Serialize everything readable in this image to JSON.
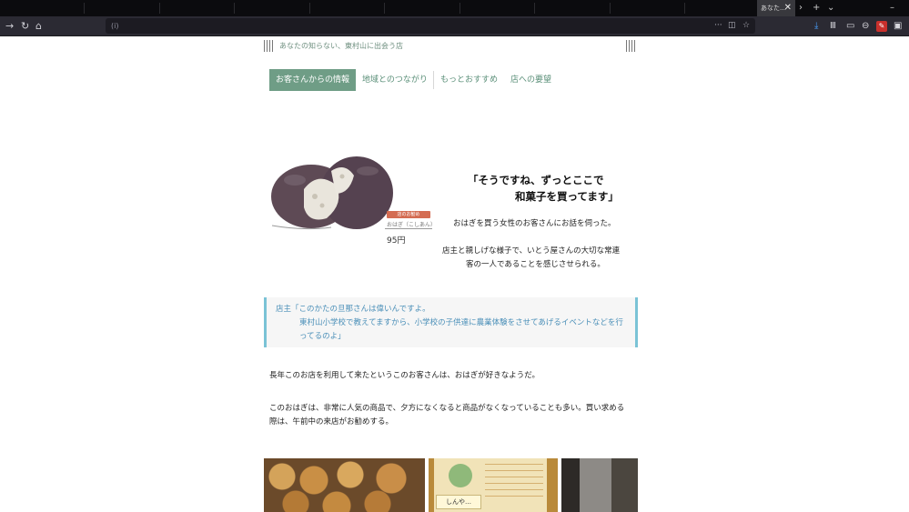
{
  "browser": {
    "tab_title": "あなた…",
    "url": "(i)"
  },
  "site": {
    "tagline": "あなたの知らない、東村山に出会う店"
  },
  "tabs": [
    {
      "label": "お客さんからの情報"
    },
    {
      "label": "地域とのつながり"
    },
    {
      "label": "もっとおすすめ"
    },
    {
      "label": "店への要望"
    }
  ],
  "product": {
    "tag": "店のお勧め",
    "name": "おはぎ（こしあん）",
    "price": "95円"
  },
  "quote": {
    "line1": "「そうですね、ずっとここで",
    "line2": "和菓子を買ってます」"
  },
  "article": {
    "lead": "おはぎを買う女性のお客さんにお話を伺った。",
    "desc_line1": "店主と親しげな様子で、いとう屋さんの大切な常連",
    "desc_line2": "客の一人であることを感じさせられる。",
    "callout_line1": "店主「このかたの旦那さんは偉いんですよ。",
    "callout_line2": "東村山小学校で教えてますから、小学校の子供達に農業体験をさせてあげるイベントなどを行",
    "callout_line3": "ってるのよ」",
    "body_line1": "長年このお店を利用して来たというこのお客さんは、おはぎが好きなようだ。",
    "body_line2": "このおはぎは、非常に人気の商品で、夕方になくなると商品がなくなっていることも多い。買い求める",
    "body_line3": "際は、午前中の来店がお勧めする。"
  },
  "photos": {
    "label2": "しんや…"
  }
}
